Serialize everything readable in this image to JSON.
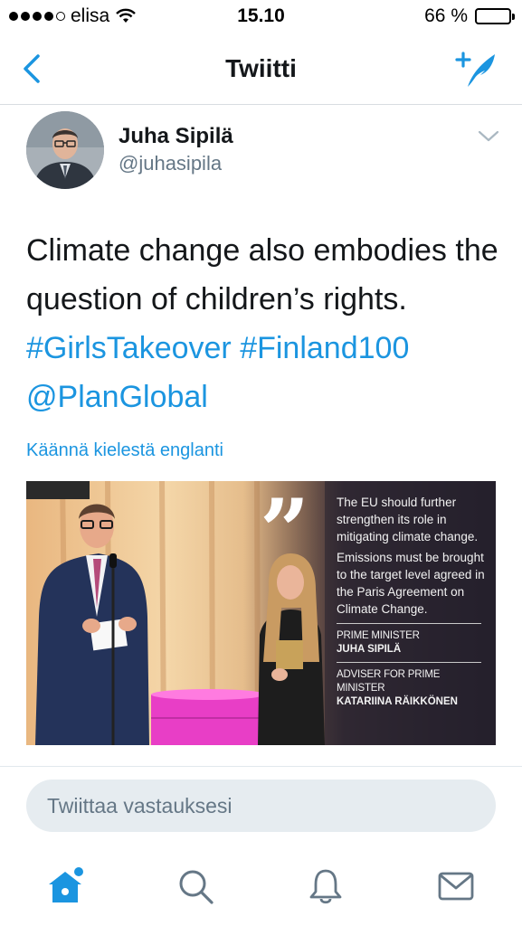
{
  "status_bar": {
    "carrier": "elisa",
    "time": "15.10",
    "battery_text": "66 %",
    "battery_level": 0.66,
    "signal_icon": "signal-dots-icon",
    "wifi_icon": "wifi-icon"
  },
  "nav": {
    "title": "Twiitti",
    "back_icon": "chevron-left-icon",
    "compose_icon": "compose-tweet-icon"
  },
  "tweet": {
    "author_name": "Juha Sipilä",
    "author_handle": "@juhasipila",
    "text_plain": "Climate change also embodies the question of children’s rights.",
    "hashtags": [
      "#GirlsTakeover",
      "#Finland100"
    ],
    "mention": "@PlanGlobal",
    "translate_label": "Käännä kielestä englanti",
    "caret_icon": "chevron-down-icon"
  },
  "media": {
    "quote_mark": "”",
    "paragraphs": [
      "The EU should further strengthen its role in mitigating climate change.",
      "Emissions must be brought to the target level agreed in the Paris Agreement on Climate Change."
    ],
    "speaker1_role": "PRIME MINISTER",
    "speaker1_name": "JUHA SIPILÄ",
    "speaker2_role": "ADVISER FOR PRIME MINISTER",
    "speaker2_name": "KATARIINA RÄIKKÖNEN"
  },
  "reply": {
    "placeholder": "Twiittaa vastauksesi"
  },
  "tabbar": {
    "tabs": [
      {
        "icon": "home-icon",
        "active": true
      },
      {
        "icon": "search-icon",
        "active": false
      },
      {
        "icon": "bell-icon",
        "active": false
      },
      {
        "icon": "mail-icon",
        "active": false
      }
    ]
  },
  "colors": {
    "accent": "#1b95e0",
    "text": "#14171a",
    "secondary": "#657786",
    "reply_bg": "#e6ecf0"
  }
}
